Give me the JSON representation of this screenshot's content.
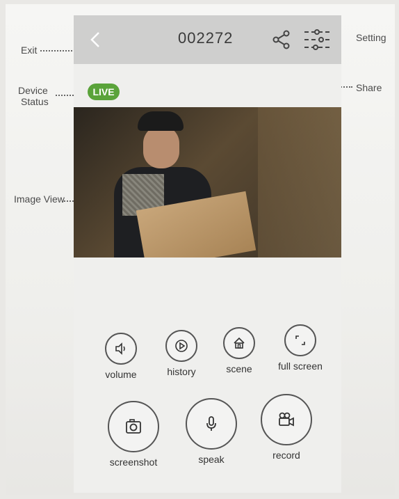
{
  "header": {
    "device_id": "002272"
  },
  "status": {
    "live_label": "LIVE",
    "live_color": "#5aa33a"
  },
  "controls": {
    "volume": "volume",
    "history": "history",
    "scene": "scene",
    "full_screen": "full screen",
    "screenshot": "screenshot",
    "speak": "speak",
    "record": "record"
  },
  "annotations": {
    "exit": "Exit",
    "device_status_1": "Device",
    "device_status_2": "Status",
    "image_view": "Image View",
    "setting": "Setting",
    "share": "Share"
  },
  "icons": {
    "back": "chevron-left-icon",
    "share": "share-icon",
    "setting": "sliders-icon",
    "volume": "speaker-icon",
    "history": "play-icon",
    "scene": "house-icon",
    "full_screen": "expand-icon",
    "screenshot": "camera-icon",
    "speak": "microphone-icon",
    "record": "video-camera-icon"
  }
}
